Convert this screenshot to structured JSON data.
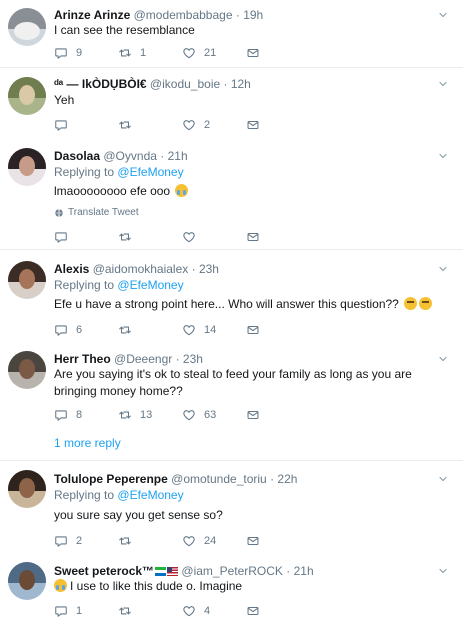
{
  "tweets": [
    {
      "name": "Arinze Arinze",
      "handle": "@modembabbage",
      "time": "· 19h",
      "text": "I can see the resemblance",
      "replies": "9",
      "retweets": "1",
      "likes": "21"
    },
    {
      "name": "ᵈᵃ — IkÒDỤBÒI€",
      "handle": "@ikodu_boie",
      "time": "· 12h",
      "text": "Yeh",
      "replies": "",
      "retweets": "",
      "likes": "2"
    },
    {
      "name": "Dasolaa",
      "handle": "@Oyvnda",
      "time": "· 21h",
      "replying_label": "Replying to",
      "replying_to": "@EfeMoney",
      "text": "lmaoooooooo efe ooo",
      "translate": "Translate Tweet",
      "replies": "",
      "retweets": "",
      "likes": ""
    },
    {
      "name": "Alexis",
      "handle": "@aidomokhaialex",
      "time": "· 23h",
      "replying_label": "Replying to",
      "replying_to": "@EfeMoney",
      "text": "Efe u have a strong point here... Who will answer this question??",
      "replies": "6",
      "retweets": "",
      "likes": "14"
    },
    {
      "name": "Herr Theo",
      "handle": "@Deeengr",
      "time": "· 23h",
      "text": "Are you saying it's ok to steal to feed your family as long as you are bringing money home??",
      "replies": "8",
      "retweets": "13",
      "likes": "63",
      "more_reply": "1 more reply"
    },
    {
      "name": "Tolulope Peperenpe",
      "handle": "@omotunde_toriu",
      "time": "· 22h",
      "replying_label": "Replying to",
      "replying_to": "@EfeMoney",
      "text": "you sure say you get sense so?",
      "replies": "2",
      "retweets": "",
      "likes": "24"
    },
    {
      "name": "Sweet peterock™",
      "handle": "@iam_PeterROCK",
      "time": "· 21h",
      "text": "I use to like this dude o. Imagine",
      "replies": "1",
      "retweets": "",
      "likes": "4"
    }
  ],
  "icons": {
    "reply": "reply-icon",
    "retweet": "retweet-icon",
    "like": "like-icon",
    "dm": "direct-message-icon",
    "caret": "chevron-down-icon",
    "globe": "globe-icon"
  },
  "colors": {
    "accent": "#1da1f2",
    "muted": "#657786",
    "divider": "#e6ecf0"
  }
}
